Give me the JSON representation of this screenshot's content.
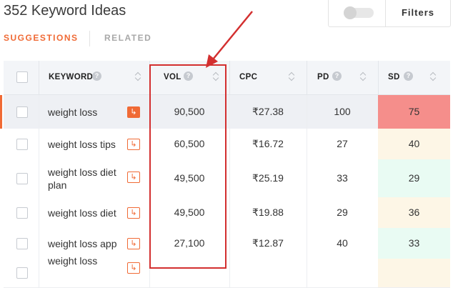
{
  "header": {
    "title": "352 Keyword Ideas",
    "filters_label": "Filters"
  },
  "tabs": {
    "suggestions": "SUGGESTIONS",
    "related": "RELATED"
  },
  "columns": {
    "keyword": "KEYWORD",
    "vol": "VOL",
    "cpc": "CPC",
    "pd": "PD",
    "sd": "SD",
    "help": "?"
  },
  "go_icon": "↳",
  "colors": {
    "accent": "#f06a35",
    "annotation": "#d32f2f",
    "sd_high": "#f58e8b",
    "sd_mid": "#fdf6e6",
    "sd_low": "#e9fbf3"
  },
  "rows": [
    {
      "keyword": "weight loss",
      "vol": "90,500",
      "cpc": "₹27.38",
      "pd": "100",
      "sd": "75"
    },
    {
      "keyword": "weight loss tips",
      "vol": "60,500",
      "cpc": "₹16.72",
      "pd": "27",
      "sd": "40"
    },
    {
      "keyword": "weight loss diet plan",
      "vol": "49,500",
      "cpc": "₹25.19",
      "pd": "33",
      "sd": "29"
    },
    {
      "keyword": "weight loss diet",
      "vol": "49,500",
      "cpc": "₹19.88",
      "pd": "29",
      "sd": "36"
    },
    {
      "keyword": "weight loss app",
      "vol": "27,100",
      "cpc": "₹12.87",
      "pd": "40",
      "sd": "33"
    },
    {
      "keyword": "weight loss",
      "vol": "",
      "cpc": "",
      "pd": "",
      "sd": ""
    }
  ]
}
